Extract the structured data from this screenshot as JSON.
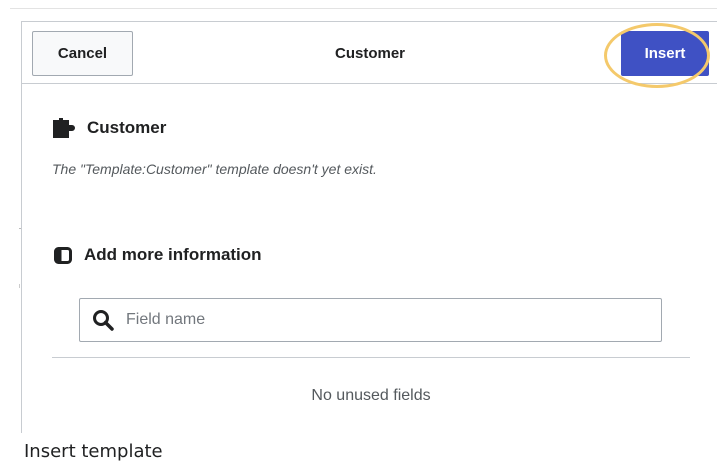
{
  "dialog": {
    "title": "Customer",
    "cancel_label": "Cancel",
    "insert_label": "Insert",
    "accent_color": "#3f51c4",
    "highlight_color": "#f4c96b"
  },
  "template": {
    "heading": "Customer",
    "icon": "puzzle-icon",
    "note": "The \"Template:Customer\" template doesn't yet exist."
  },
  "more_info": {
    "heading": "Add more information",
    "icon": "panel-icon",
    "search": {
      "placeholder": "Field name",
      "value": "",
      "icon": "search-icon"
    },
    "empty_message": "No unused fields"
  },
  "caption": "Insert template"
}
